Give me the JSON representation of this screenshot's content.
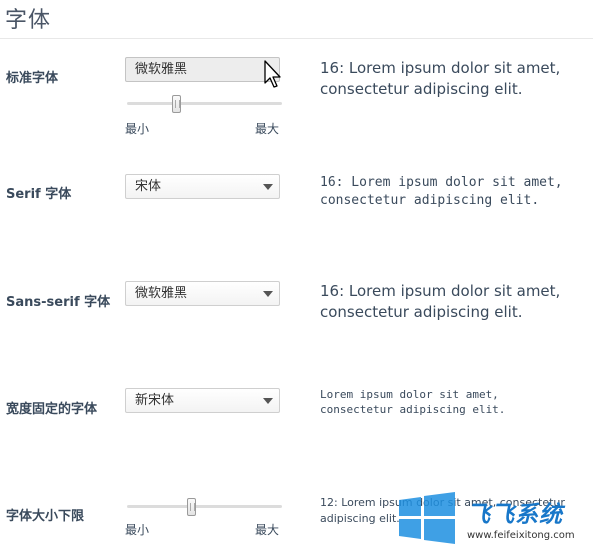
{
  "page": {
    "title": "字体"
  },
  "standard_font": {
    "label": "标准字体",
    "selected": "微软雅黑",
    "slider": {
      "min_label": "最小",
      "max_label": "最大",
      "value_fraction": 0.31
    },
    "preview": "16: Lorem ipsum dolor sit amet, consectetur adipiscing elit."
  },
  "serif_font": {
    "label": "Serif 字体",
    "selected": "宋体",
    "preview": "16: Lorem ipsum dolor sit amet, consectetur adipiscing elit."
  },
  "sans_serif_font": {
    "label": "Sans-serif 字体",
    "selected": "微软雅黑",
    "preview": "16: Lorem ipsum dolor sit amet, consectetur adipiscing elit."
  },
  "fixed_width_font": {
    "label": "宽度固定的字体",
    "selected": "新宋体",
    "preview": "Lorem ipsum dolor sit amet, consectetur adipiscing elit."
  },
  "min_font_size": {
    "label": "字体大小下限",
    "slider": {
      "min_label": "最小",
      "max_label": "最大",
      "value_fraction": 0.41
    },
    "preview": "12: Lorem ipsum dolor sit amet, consectetur adipiscing elit."
  },
  "watermark": {
    "brand": "飞飞系统",
    "url": "www.feifeixitong.com"
  },
  "icons": {
    "cursor": "mouse-pointer-icon",
    "dropdown": "chevron-down-icon",
    "watermark_logo": "windows-logo-icon"
  },
  "colors": {
    "label": "#3a4a5c",
    "title": "#4a5566",
    "brand": "#1877c9"
  }
}
